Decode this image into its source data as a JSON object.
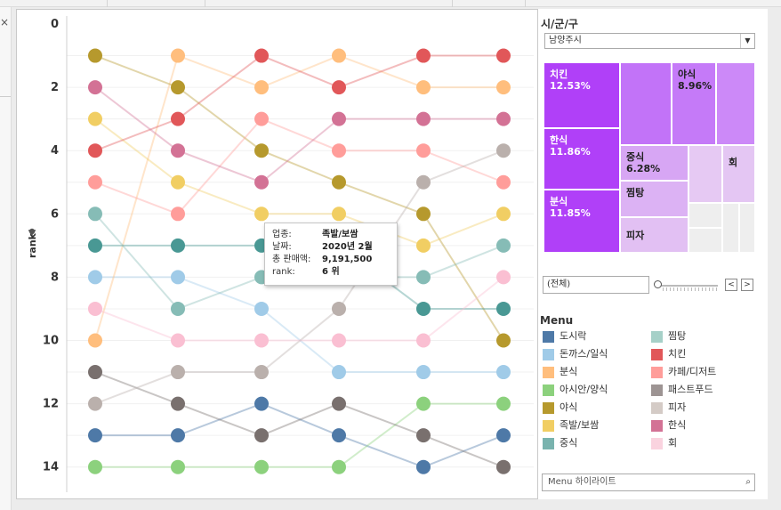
{
  "window": {
    "close_glyph": "×"
  },
  "chart_data": {
    "type": "line",
    "ylabel": "rank",
    "ylabel_icon": "pin-icon",
    "y_reversed": true,
    "ylim": [
      0,
      14
    ],
    "y_ticks": [
      "0",
      "2",
      "4",
      "6",
      "8",
      "10",
      "12",
      "14"
    ],
    "x_categories": [
      "",
      "",
      "",
      "",
      "",
      ""
    ],
    "series": [
      {
        "name": "도시락",
        "color": "#4E79A7",
        "values": [
          13,
          13,
          12,
          13,
          14,
          13
        ]
      },
      {
        "name": "돈까스/일식",
        "color": "#A0CBE8",
        "values": [
          8,
          8,
          9,
          11,
          11,
          11
        ]
      },
      {
        "name": "분식",
        "color": "#FFBE7D",
        "values": [
          10,
          1,
          2,
          1,
          2,
          2
        ]
      },
      {
        "name": "아시안/양식",
        "color": "#8CD17D",
        "values": [
          14,
          14,
          14,
          14,
          12,
          12
        ]
      },
      {
        "name": "야식",
        "color": "#B6992D",
        "values": [
          1,
          2,
          4,
          5,
          6,
          10
        ]
      },
      {
        "name": "족발/보쌈",
        "color": "#F1CE63",
        "values": [
          3,
          5,
          6,
          6,
          7,
          6
        ]
      },
      {
        "name": "중식",
        "color": "#499894",
        "values": [
          7,
          7,
          7,
          7,
          9,
          9
        ]
      },
      {
        "name": "찜탕",
        "color": "#86BCB6",
        "values": [
          6,
          9,
          8,
          8,
          8,
          7
        ]
      },
      {
        "name": "치킨",
        "color": "#E15759",
        "values": [
          4,
          3,
          1,
          2,
          1,
          1
        ]
      },
      {
        "name": "카페/디저트",
        "color": "#FF9D9A",
        "values": [
          5,
          6,
          3,
          4,
          4,
          5
        ]
      },
      {
        "name": "패스트푸드",
        "color": "#79706E",
        "values": [
          11,
          12,
          13,
          12,
          13,
          14
        ]
      },
      {
        "name": "피자",
        "color": "#BAB0AC",
        "values": [
          12,
          11,
          11,
          9,
          5,
          4
        ]
      },
      {
        "name": "한식",
        "color": "#D37295",
        "values": [
          2,
          4,
          5,
          3,
          3,
          3
        ]
      },
      {
        "name": "회",
        "color": "#FABFD2",
        "values": [
          9,
          10,
          10,
          10,
          10,
          8
        ]
      }
    ]
  },
  "tooltip": {
    "rows": [
      {
        "key": "업종:",
        "value": "족발/보쌈"
      },
      {
        "key": "날짜:",
        "value": "2020년 2월"
      },
      {
        "key": "총 판매액:",
        "value": "9,191,500"
      },
      {
        "key": "rank:",
        "value": "6 위"
      }
    ]
  },
  "filter": {
    "title": "시/군/구",
    "selected": "남양주시",
    "dropdown_icon": "chevron-down-icon"
  },
  "treemap": {
    "cells": [
      {
        "label": "치킨",
        "value": "12.53%",
        "color": "#B040F8"
      },
      {
        "label": "한식",
        "value": "11.86%",
        "color": "#B040F8"
      },
      {
        "label": "분식",
        "value": "11.85%",
        "color": "#B040F8"
      },
      {
        "label": "",
        "value": "",
        "color": "#C273F8"
      },
      {
        "label": "야식",
        "value": "8.96%",
        "color": "#C57AF8"
      },
      {
        "label": "",
        "value": "",
        "color": "#CC89F8"
      },
      {
        "label": "중식",
        "value": "6.28%",
        "color": "#D7A6F4"
      },
      {
        "label": "찜탕",
        "value": "",
        "color": "#DCB2F4"
      },
      {
        "label": "피자",
        "value": "",
        "color": "#E2C0F3"
      },
      {
        "label": "",
        "value": "",
        "color": "#E6C9F3"
      },
      {
        "label": "회",
        "value": "",
        "color": "#E4C6F3"
      },
      {
        "label": "",
        "value": "",
        "color": "#EEEEEE"
      },
      {
        "label": "",
        "value": "",
        "color": "#EEEEEE"
      },
      {
        "label": "",
        "value": "",
        "color": "#EEEEEE"
      },
      {
        "label": "",
        "value": "",
        "color": "#EEEEEE"
      }
    ]
  },
  "date_range": {
    "value": "(전체)",
    "prev_glyph": "<",
    "next_glyph": ">"
  },
  "legend": {
    "title": "Menu",
    "items": [
      {
        "label": "도시락",
        "color": "#4E79A7"
      },
      {
        "label": "찜탕",
        "color": "#A6D0C8"
      },
      {
        "label": "돈까스/일식",
        "color": "#A0CBE8"
      },
      {
        "label": "치킨",
        "color": "#E15759"
      },
      {
        "label": "분식",
        "color": "#FFBE7D"
      },
      {
        "label": "카페/디저트",
        "color": "#FF9D9A"
      },
      {
        "label": "아시안/양식",
        "color": "#8CD17D"
      },
      {
        "label": "패스트푸드",
        "color": "#9D9493"
      },
      {
        "label": "야식",
        "color": "#B6992D"
      },
      {
        "label": "피자",
        "color": "#D4CBC6"
      },
      {
        "label": "족발/보쌈",
        "color": "#F1CE63"
      },
      {
        "label": "한식",
        "color": "#D37295"
      },
      {
        "label": "중식",
        "color": "#79B3AE"
      },
      {
        "label": "회",
        "color": "#FAD3DF"
      }
    ]
  },
  "search": {
    "placeholder": "Menu 하이라이트",
    "icon": "search-icon"
  }
}
